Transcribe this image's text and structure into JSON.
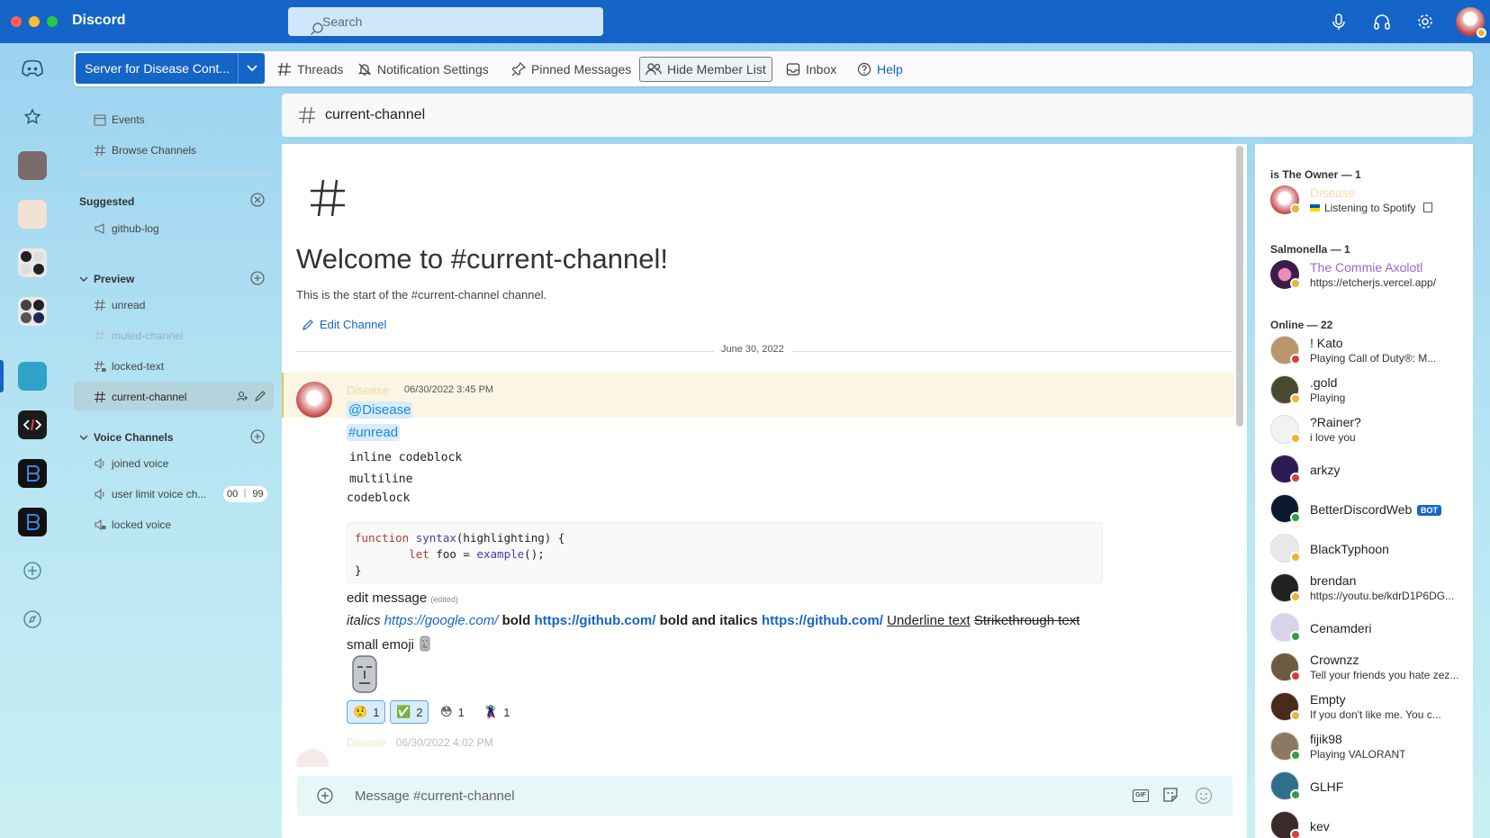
{
  "app": {
    "title": "Discord"
  },
  "search": {
    "placeholder": "Search"
  },
  "toolbar": {
    "server_name": "Server for Disease Cont...",
    "threads": "Threads",
    "notification_settings": "Notification Settings",
    "pinned_messages": "Pinned Messages",
    "hide_member_list": "Hide Member List",
    "inbox": "Inbox",
    "help": "Help"
  },
  "sidebar": {
    "events": "Events",
    "browse_channels": "Browse Channels",
    "suggested_header": "Suggested",
    "suggested_channel": "github-log",
    "preview_header": "Preview",
    "preview_channels": [
      "unread",
      "muted-channel",
      "locked-text",
      "current-channel"
    ],
    "voice_header": "Voice Channels",
    "voice_channels": [
      "joined voice",
      "user limit voice ch...",
      "locked voice"
    ],
    "voice_limit": {
      "current": "00",
      "max": "99"
    }
  },
  "channel": {
    "name": "current-channel",
    "welcome_title": "Welcome to #current-channel!",
    "welcome_sub": "This is the start of the #current-channel channel.",
    "edit_channel": "Edit Channel"
  },
  "date_divider": "June 30, 2022",
  "message": {
    "author": "Disease",
    "timestamp": "06/30/2022 3:45 PM",
    "mention_user": "@Disease",
    "mention_channel": "#unread",
    "inline_code": "inline codeblock",
    "multiline_1": "multiline",
    "multiline_2": "codeblock",
    "code_lines": [
      "function syntax(highlighting) {",
      "    let foo = example();",
      "}"
    ],
    "edit_text": "edit message",
    "edited_tag": "(edited)",
    "italics": "italics",
    "link1": "https://google.com/",
    "bold": "bold",
    "link2": "https://github.com/",
    "bold_italics": "bold and italics",
    "link3": "https://github.com/",
    "underline": "Underline text",
    "strikethrough": "Strikethrough text",
    "small_emoji": "small emoji",
    "reactions": [
      {
        "emoji": "🤨",
        "count": "1",
        "selected": true
      },
      {
        "emoji": "✅",
        "count": "2",
        "selected": true
      },
      {
        "emoji": "😳",
        "count": "1",
        "selected": false
      },
      {
        "emoji": "🦹",
        "count": "1",
        "selected": false
      }
    ]
  },
  "next_message": {
    "author": "Disease",
    "timestamp": "06/30/2022 4:02 PM"
  },
  "composer": {
    "placeholder": "Message #current-channel",
    "gif": "GIF"
  },
  "members": {
    "owner_header": "is The Owner — 1",
    "owner": {
      "name": "Disease",
      "activity": "Listening to Spotify"
    },
    "salmonella_header": "Salmonella — 1",
    "salmonella": {
      "name": "The Commie Axolotl",
      "activity": "https://etcherjs.vercel.app/"
    },
    "online_header": "Online — 22",
    "online": [
      {
        "name": "! Kato",
        "activity": "Playing Call of Duty®: M...",
        "status": "dnd",
        "color": "#b9956a"
      },
      {
        "name": ".gold",
        "activity": "Playing",
        "status": "idle",
        "color": "#4a4a30"
      },
      {
        "name": "?Rainer?",
        "activity": "i love you",
        "status": "idle",
        "color": "#f2f2f2"
      },
      {
        "name": "arkzy",
        "activity": "",
        "status": "dnd",
        "color": "#2d1b55"
      },
      {
        "name": "BetterDiscordWeb",
        "activity": "",
        "status": "online",
        "bot": "BOT",
        "color": "#0b1a2e"
      },
      {
        "name": "BlackTyphoon",
        "activity": "",
        "status": "idle",
        "color": "#e8e8e8"
      },
      {
        "name": "brendan",
        "activity": "https://youtu.be/kdrD1P6DG...",
        "status": "idle",
        "color": "#222222"
      },
      {
        "name": "Cenamderi",
        "activity": "",
        "status": "online",
        "color": "#d9d2e8"
      },
      {
        "name": "Crownzz",
        "activity": "Tell your friends you hate zez...",
        "status": "dnd",
        "color": "#6e5a3e"
      },
      {
        "name": "Empty",
        "activity": "If you don't like me. You c...",
        "status": "idle",
        "color": "#4a2a1a"
      },
      {
        "name": "fijik98",
        "activity": "Playing VALORANT",
        "status": "online",
        "color": "#8a7a62"
      },
      {
        "name": "GLHF",
        "activity": "",
        "status": "online",
        "color": "#2e6f8e"
      },
      {
        "name": "kev",
        "activity": "",
        "status": "dnd",
        "color": "#3a2a2a"
      }
    ]
  },
  "colors": {
    "accent": "#1565c8",
    "titlebar": "#1565c8",
    "online": "#2ea043",
    "idle": "#f0b232",
    "dnd": "#d83c3e"
  }
}
